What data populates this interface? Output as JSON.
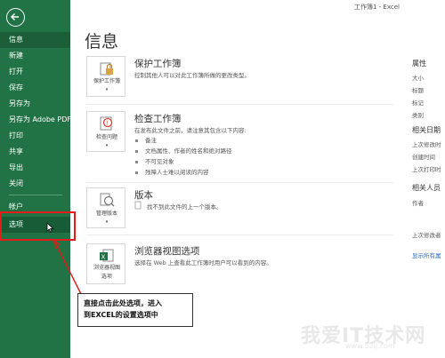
{
  "window": {
    "title": "工作簿1 - Excel"
  },
  "sidebar": {
    "items": [
      {
        "label": "信息"
      },
      {
        "label": "新建"
      },
      {
        "label": "打开"
      },
      {
        "label": "保存"
      },
      {
        "label": "另存为"
      },
      {
        "label": "另存为 Adobe PDF"
      },
      {
        "label": "打印"
      },
      {
        "label": "共享"
      },
      {
        "label": "导出"
      },
      {
        "label": "关闭"
      },
      {
        "label": "帐户"
      },
      {
        "label": "选项"
      }
    ]
  },
  "main": {
    "title": "信息",
    "sections": {
      "protect": {
        "card_label": "保护工作簿",
        "title": "保护工作簿",
        "desc": "控制其他人可以对此工作簿所做的更改类型。"
      },
      "inspect": {
        "card_label": "检查问题",
        "title": "检查工作簿",
        "desc": "在发布此文件之前，请注意其包含以下内容:",
        "bullets": [
          "备注",
          "文档属性、作者的姓名和绝对路径",
          "不可见对象",
          "残障人士难以阅读的内容"
        ]
      },
      "version": {
        "card_label": "管理版本",
        "title": "版本",
        "desc": "找不到此文件的上一个版本。"
      },
      "browser": {
        "card_label_1": "浏览器视图",
        "card_label_2": "选项",
        "title": "浏览器视图选项",
        "desc": "选择在 Web 上查看此工作簿时用户可以看到的内容。"
      }
    }
  },
  "right_panel": {
    "properties_head": "属性",
    "props": [
      "大小",
      "标题",
      "标记",
      "类别"
    ],
    "dates_head": "相关日期",
    "dates": [
      "上次修改时",
      "创建时间",
      "上次打印时"
    ],
    "people_head": "相关人员",
    "people": [
      "作者",
      "上次修改者"
    ],
    "show_all": "显示所有属"
  },
  "annotation": {
    "line1": "直接点击此处选项，进入",
    "line2": "到EXCEL的设置选项中"
  },
  "watermark": {
    "text": "我爱IT技术网",
    "url": "www.52ij.com"
  },
  "colors": {
    "sidebar": "#217346",
    "annotation": "#e21b1b",
    "link": "#2a6ebb"
  },
  "icons": [
    "back-arrow-icon",
    "lock-icon",
    "inspect-icon",
    "version-icon",
    "browser-view-icon",
    "cursor-icon"
  ]
}
